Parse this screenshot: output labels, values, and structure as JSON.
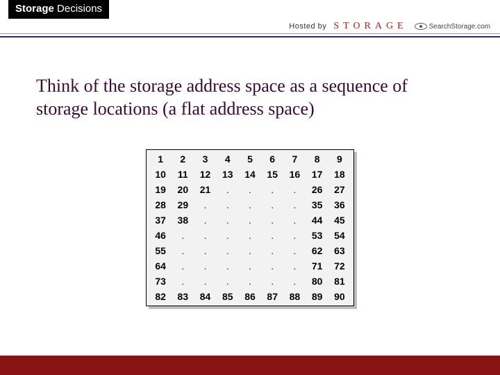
{
  "header": {
    "badge_bold": "Storage",
    "badge_light": "Decisions",
    "hosted_by": "Hosted by",
    "storage_logo_text": "STORAGE",
    "search_storage_text": "SearchStorage.com"
  },
  "title": "Think of the storage address space as a sequence of storage locations (a flat address space)",
  "grid": {
    "rows": [
      [
        "1",
        "2",
        "3",
        "4",
        "5",
        "6",
        "7",
        "8",
        "9"
      ],
      [
        "10",
        "11",
        "12",
        "13",
        "14",
        "15",
        "16",
        "17",
        "18"
      ],
      [
        "19",
        "20",
        "21",
        ".",
        ".",
        ".",
        ".",
        "26",
        "27"
      ],
      [
        "28",
        "29",
        ".",
        ".",
        ".",
        ".",
        ".",
        "35",
        "36"
      ],
      [
        "37",
        "38",
        ".",
        ".",
        ".",
        ".",
        ".",
        "44",
        "45"
      ],
      [
        "46",
        ".",
        ".",
        ".",
        ".",
        ".",
        ".",
        "53",
        "54"
      ],
      [
        "55",
        ".",
        ".",
        ".",
        ".",
        ".",
        ".",
        "62",
        "63"
      ],
      [
        "64",
        ".",
        ".",
        ".",
        ".",
        ".",
        ".",
        "71",
        "72"
      ],
      [
        "73",
        ".",
        ".",
        ".",
        ".",
        ".",
        ".",
        "80",
        "81"
      ],
      [
        "82",
        "83",
        "84",
        "85",
        "86",
        "87",
        "88",
        "89",
        "90"
      ]
    ]
  },
  "colors": {
    "title": "#3a0a33",
    "footer": "#8a1414",
    "storage_logo": "#a02828"
  }
}
